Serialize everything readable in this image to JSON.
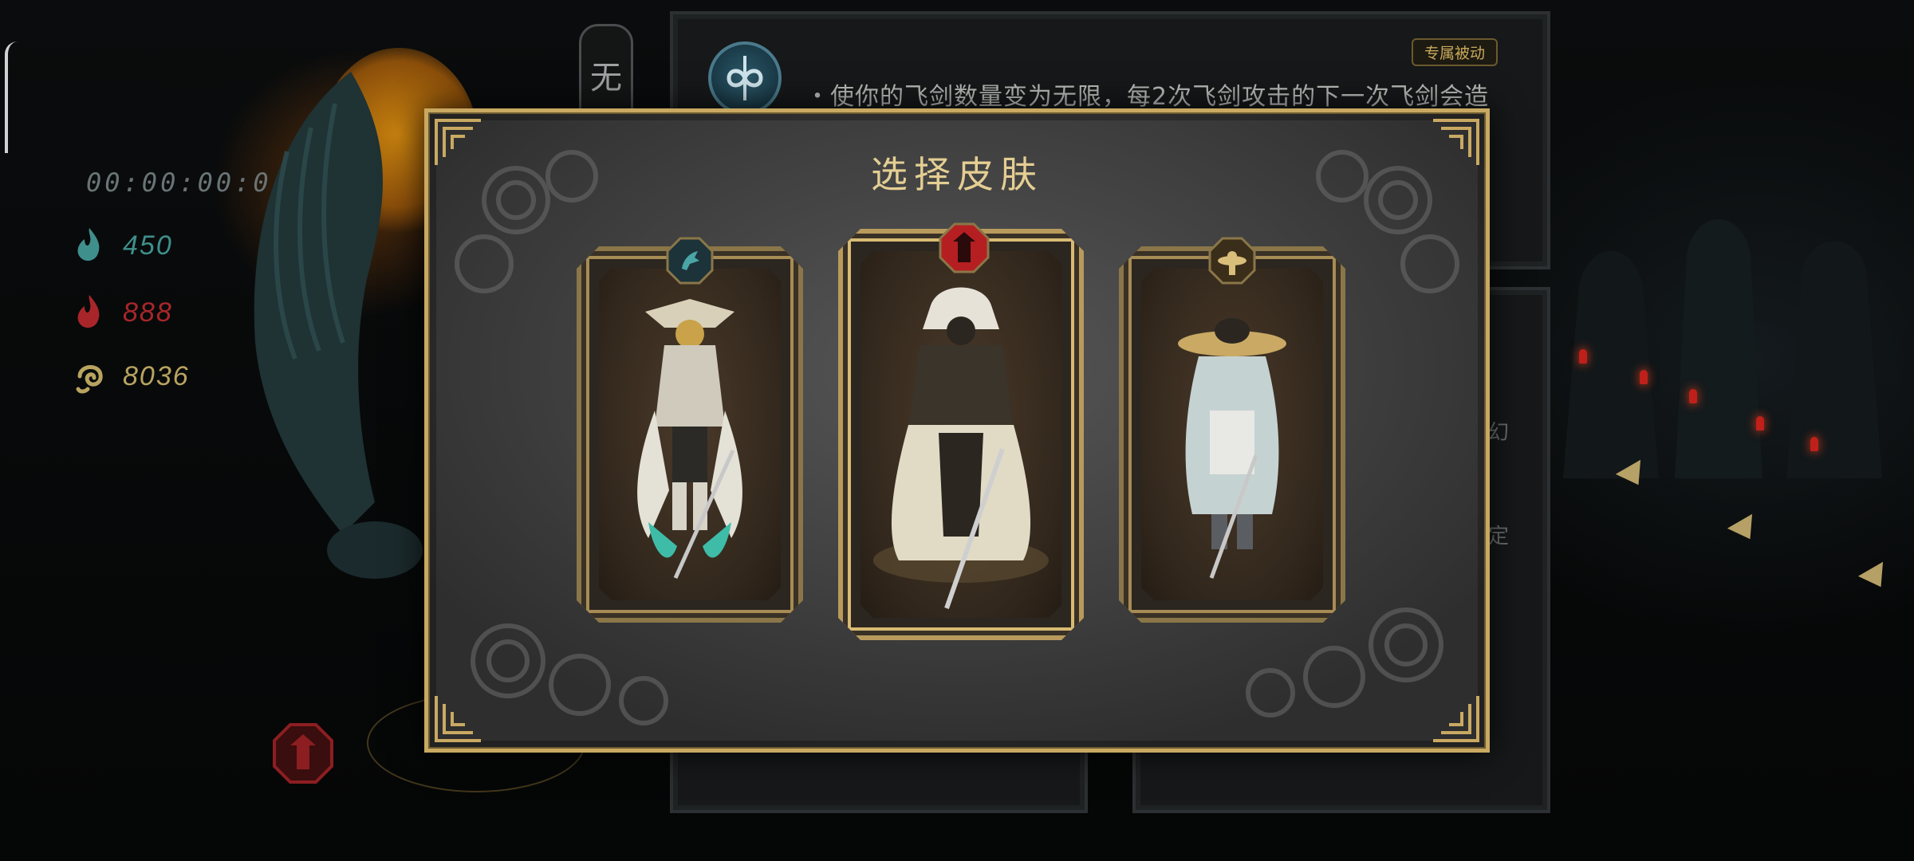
{
  "hud": {
    "timer": "00:00:00:0",
    "resources": [
      {
        "icon": "teal-flame-icon",
        "value": "450",
        "color": "#3f8f8c"
      },
      {
        "icon": "red-flame-icon",
        "value": "888",
        "color": "#a8262a"
      },
      {
        "icon": "gold-swirl-icon",
        "value": "8036",
        "color": "#b8a460"
      }
    ]
  },
  "background": {
    "vertical_label": "无",
    "tag": "专属被动",
    "description": "・使你的飞剑数量变为无限，每2次飞剑攻击的下一次飞剑会造",
    "side_texts": [
      "幻",
      "定"
    ]
  },
  "dialog": {
    "title": "选择皮肤",
    "skins": [
      {
        "name": "skin-card-feathered-knight",
        "badge_color": "#2d5560",
        "badge_icon": "teal-horse-emblem-icon",
        "accent": "#3fbca8",
        "selected": false
      },
      {
        "name": "skin-card-hooded-swordsman",
        "badge_color": "#b51f22",
        "badge_icon": "red-crest-emblem-icon",
        "accent": "#d9c7a0",
        "selected": true
      },
      {
        "name": "skin-card-straw-hat-wanderer",
        "badge_color": "#4a3a20",
        "badge_icon": "gold-hat-emblem-icon",
        "accent": "#c9a964",
        "selected": false
      }
    ]
  },
  "colors": {
    "frame_gold": "#c9a962",
    "title_gold": "#e4ce93"
  }
}
